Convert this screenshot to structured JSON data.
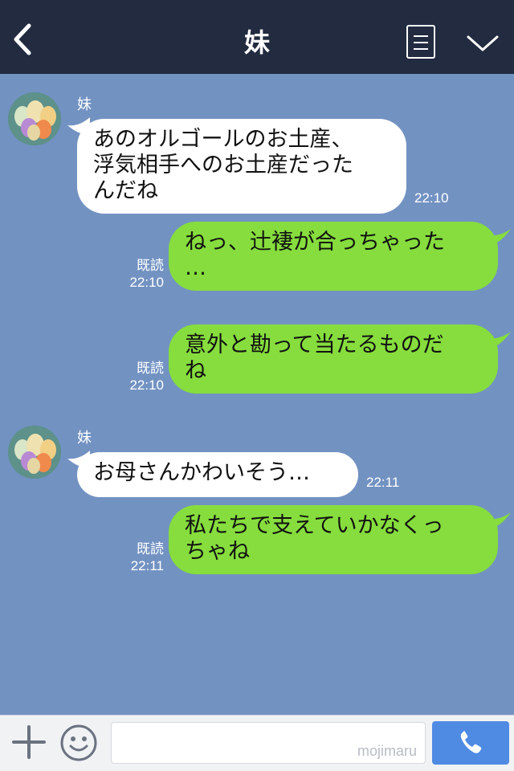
{
  "header": {
    "title": "妹",
    "back_icon": "chevron-left-icon",
    "menu_icon": "menu-list-icon",
    "collapse_icon": "chevron-down-icon",
    "bg_color": "#222b40"
  },
  "chat": {
    "bg_color": "#7292c2",
    "incoming_color": "#ffffff",
    "outgoing_color": "#86dd3d",
    "messages": [
      {
        "direction": "in",
        "sender": "妹",
        "text": "あのオルゴールのお土産、\n浮気相手へのお土産だった\nんだね",
        "time": "22:10"
      },
      {
        "direction": "out",
        "read": "既読",
        "text": "ねっ、辻褄が合っちゃった\n…",
        "time": "22:10"
      },
      {
        "direction": "out",
        "read": "既読",
        "text": "意外と勘って当たるものだ\nね",
        "time": "22:10"
      },
      {
        "direction": "in",
        "sender": "妹",
        "text": "お母さんかわいそう…",
        "time": "22:11"
      },
      {
        "direction": "out",
        "read": "既読",
        "text": "私たちで支えていかなくっ\nちゃね",
        "time": "22:11"
      }
    ]
  },
  "bottom_bar": {
    "plus_icon": "plus-icon",
    "emoji_icon": "smiley-icon",
    "input_value": "",
    "watermark": "mojimaru",
    "call_icon": "phone-icon",
    "call_color": "#4f8be3"
  }
}
